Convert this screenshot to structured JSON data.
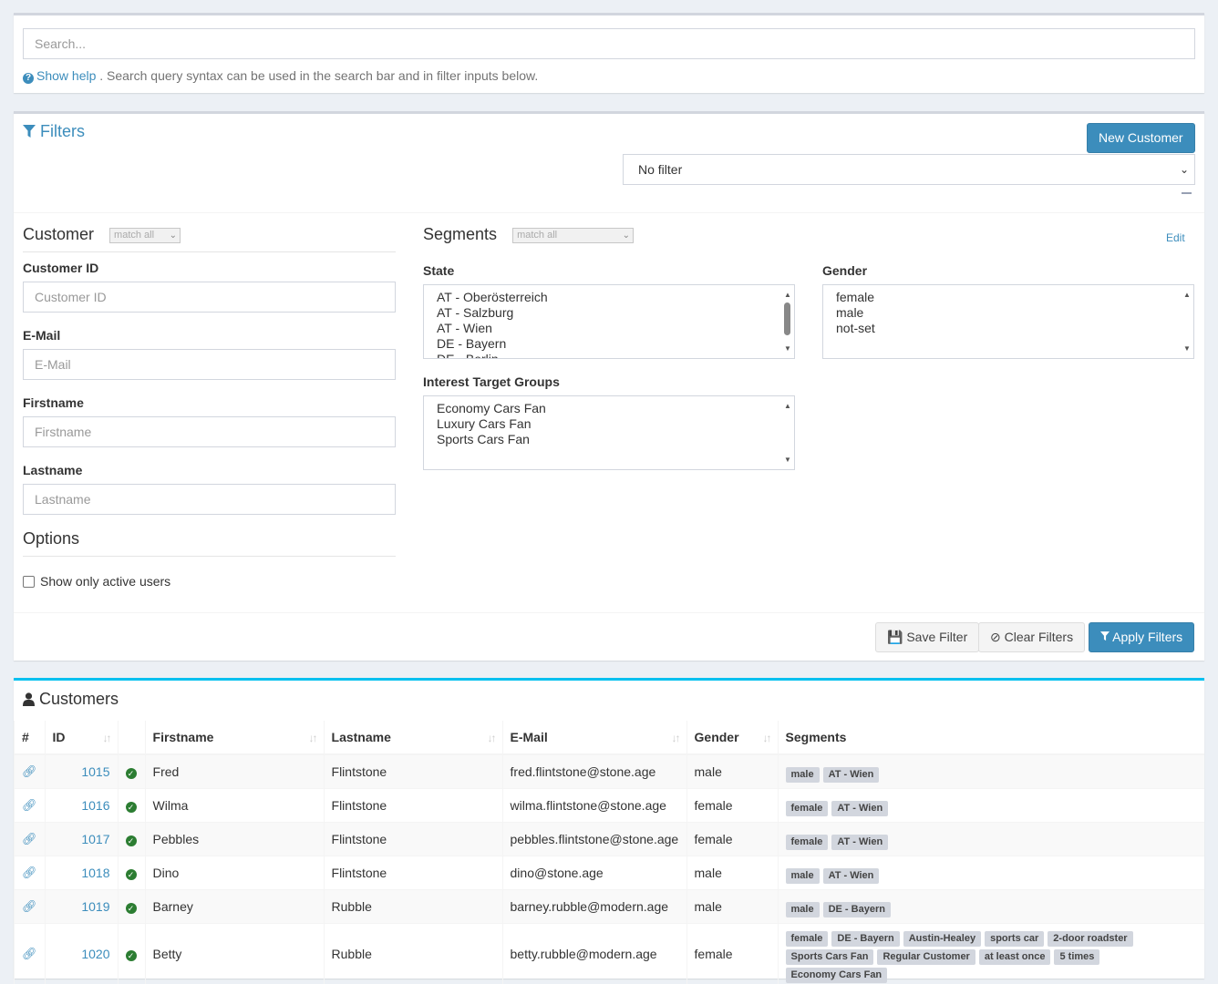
{
  "search": {
    "placeholder": "Search...",
    "help_link": "Show help",
    "help_text": " . Search query syntax can be used in the search bar and in filter inputs below."
  },
  "filters": {
    "title": "Filters",
    "new_customer": "New Customer",
    "saved_filter_value": "No filter",
    "customer_section": {
      "title": "Customer",
      "match": "match all"
    },
    "segments_section": {
      "title": "Segments",
      "match": "match all",
      "edit": "Edit"
    },
    "fields": [
      {
        "label": "Customer ID",
        "placeholder": "Customer ID"
      },
      {
        "label": "E-Mail",
        "placeholder": "E-Mail"
      },
      {
        "label": "Firstname",
        "placeholder": "Firstname"
      },
      {
        "label": "Lastname",
        "placeholder": "Lastname"
      }
    ],
    "state": {
      "label": "State",
      "options": [
        "AT - Oberösterreich",
        "AT - Salzburg",
        "AT - Wien",
        "DE - Bayern",
        "DE - Berlin"
      ]
    },
    "gender": {
      "label": "Gender",
      "options": [
        "female",
        "male",
        "not-set"
      ]
    },
    "interest": {
      "label": "Interest Target Groups",
      "options": [
        "Economy Cars Fan",
        "Luxury Cars Fan",
        "Sports Cars Fan"
      ]
    },
    "options_section": {
      "title": "Options",
      "active_users": "Show only active users"
    },
    "buttons": {
      "save": "Save Filter",
      "clear": "Clear Filters",
      "apply": "Apply Filters"
    }
  },
  "customers": {
    "title": "Customers",
    "columns": [
      "#",
      "ID",
      "",
      "Firstname",
      "Lastname",
      "E-Mail",
      "Gender",
      "Segments"
    ],
    "rows": [
      {
        "id": "1015",
        "firstname": "Fred",
        "lastname": "Flintstone",
        "email": "fred.flintstone@stone.age",
        "gender": "male",
        "segments": [
          "male",
          "AT - Wien"
        ]
      },
      {
        "id": "1016",
        "firstname": "Wilma",
        "lastname": "Flintstone",
        "email": "wilma.flintstone@stone.age",
        "gender": "female",
        "segments": [
          "female",
          "AT - Wien"
        ]
      },
      {
        "id": "1017",
        "firstname": "Pebbles",
        "lastname": "Flintstone",
        "email": "pebbles.flintstone@stone.age",
        "gender": "female",
        "segments": [
          "female",
          "AT - Wien"
        ]
      },
      {
        "id": "1018",
        "firstname": "Dino",
        "lastname": "Flintstone",
        "email": "dino@stone.age",
        "gender": "male",
        "segments": [
          "male",
          "AT - Wien"
        ]
      },
      {
        "id": "1019",
        "firstname": "Barney",
        "lastname": "Rubble",
        "email": "barney.rubble@modern.age",
        "gender": "male",
        "segments": [
          "male",
          "DE - Bayern"
        ]
      },
      {
        "id": "1020",
        "firstname": "Betty",
        "lastname": "Rubble",
        "email": "betty.rubble@modern.age",
        "gender": "female",
        "segments": [
          "female",
          "DE - Bayern",
          "Austin-Healey",
          "sports car",
          "2-door roadster",
          "Sports Cars Fan",
          "Regular Customer",
          "at least once",
          "5 times",
          "Economy Cars Fan"
        ]
      }
    ]
  },
  "colors": {
    "primary": "#3c8dbc",
    "active": "#2c7d32",
    "accent_border": "#00c0ef"
  }
}
